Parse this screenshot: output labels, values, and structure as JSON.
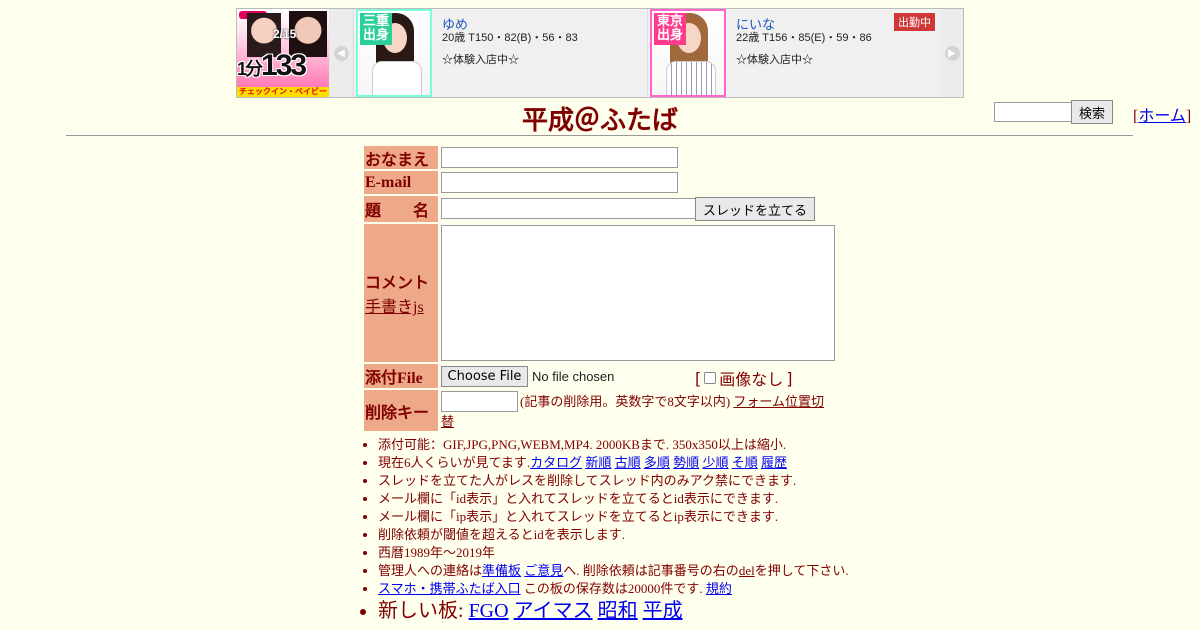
{
  "banner": {
    "ad": {
      "top_text": "2/15",
      "big_pre": "1分",
      "big_price": "133円",
      "strip": "チェックイン・ベイビー"
    },
    "cards": [
      {
        "tag": "三重出身",
        "name": "ゆめ",
        "stats": "20歳 T150・82(B)・56・83",
        "note": "☆体験入店中☆",
        "badge": ""
      },
      {
        "tag": "東京出身",
        "name": "にいな",
        "stats": "22歳 T156・85(E)・59・86",
        "note": "☆体験入店中☆",
        "badge": "出勤中"
      }
    ],
    "prev_icon": "chevron-left-icon",
    "next_icon": "chevron-right-icon"
  },
  "header": {
    "title": "平成＠ふたば",
    "search_button": "検索",
    "search_value": "",
    "home_link": "ホーム",
    "bracket_open": "[",
    "bracket_close": "]"
  },
  "form": {
    "name_label": "おなまえ",
    "email_label": "E-mail",
    "subject_label": "題　　名",
    "submit_button": "スレッドを立てる",
    "comment_label": "コメント",
    "handwriting_link": "手書きjs",
    "attach_label": "添付File",
    "choose_file_button": "Choose File",
    "no_file_text": "No file chosen",
    "noimage_label": "画像なし",
    "delkey_label": "削除キー",
    "delkey_note": "(記事の削除用。英数字で8文字以内)",
    "form_position_link": "フォーム位置切替"
  },
  "notes": {
    "n1": "添付可能：GIF,JPG,PNG,WEBM,MP4. 2000KBまで. 350x350以上は縮小.",
    "n2_prefix": "現在6人くらいが見てます.",
    "n2_links": [
      "カタログ",
      "新順",
      "古順",
      "多順",
      "勢順",
      "少順",
      "そ順",
      "履歴"
    ],
    "n3": "スレッドを立てた人がレスを削除してスレッド内のみアク禁にできます.",
    "n4": "メール欄に「id表示」と入れてスレッドを立てるとid表示にできます.",
    "n5": "メール欄に「ip表示」と入れてスレッドを立てるとip表示にできます.",
    "n6": "削除依頼が閾値を超えるとidを表示します.",
    "n7": "西暦1989年～2019年",
    "n8_prefix": "管理人への連絡は",
    "n8_link1": "準備板",
    "n8_link2": "ご意見",
    "n8_mid": "へ. 削除依頼は記事番号の右の",
    "n8_link3": "del",
    "n8_suffix": "を押して下さい.",
    "n9_link1": "スマホ・携帯ふたば入口",
    "n9_mid": "この板の保存数は20000件です.",
    "n9_link2": "規約",
    "n10_prefix": "新しい板:",
    "n10_links": [
      "FGO",
      "アイマス",
      "昭和",
      "平成"
    ]
  }
}
